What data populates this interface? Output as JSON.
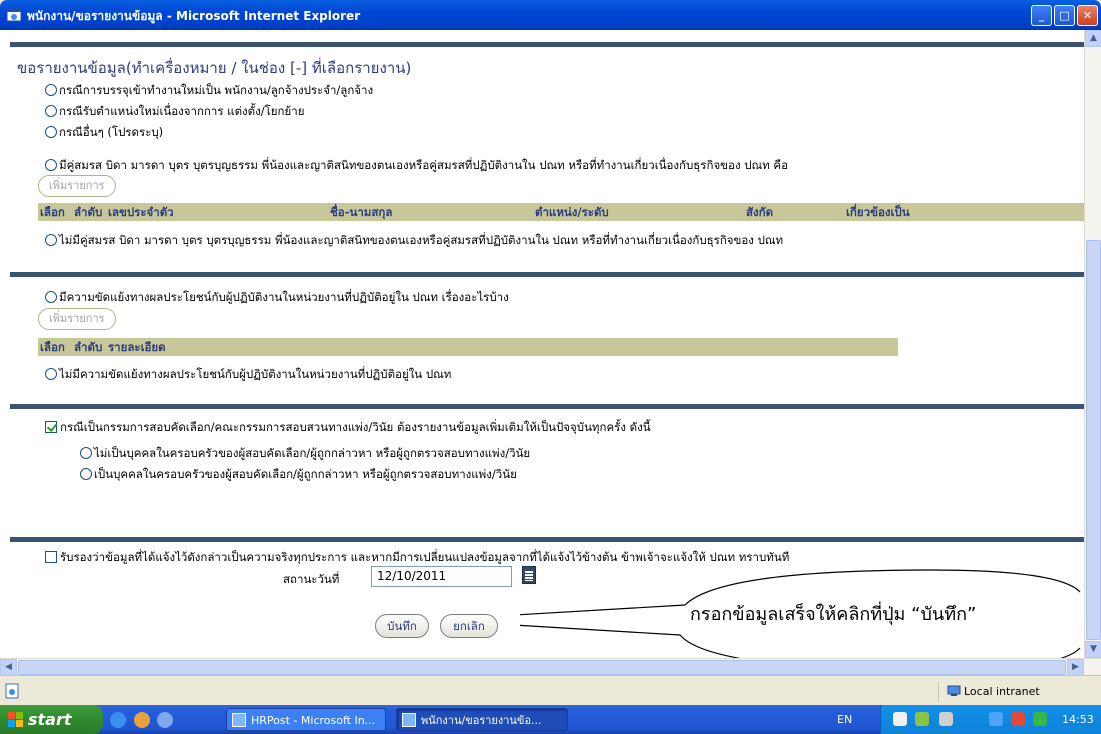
{
  "window": {
    "title": "พนักงาน/ขอรายงานข้อมูล - Microsoft Internet Explorer",
    "min": "_",
    "max": "□",
    "close": "✕"
  },
  "page": {
    "heading": "ขอรายงานข้อมูล(ทำเครื่องหมาย / ในช่อง [-] ที่เลือกรายงาน)",
    "section1": {
      "options": [
        "กรณีการบรรจุเข้าทำงานใหม่เป็น พนักงาน/ลูกจ้างประจำ/ลูกจ้าง",
        "กรณีรับตำแหน่งใหม่เนื่องจากการ แต่งตั้ง/โยกย้าย",
        "กรณีอื่นๆ (โปรดระบุ)"
      ]
    },
    "section2": {
      "has_relatives": "มีคู่สมรส บิดา มารดา บุตร บุตรบุญธรรม พี่น้องและญาติสนิทของตนเองหรือคู่สมรสที่ปฏิบัติงานใน ปณท หรือที่ทำงานเกี่ยวเนื่องกับธุรกิจของ ปณท คือ",
      "add_button": "เพิ่มรายการ",
      "table_headers": [
        "เลือก",
        "ลำดับ",
        "เลขประจำตัว",
        "ชื่อ-นามสกุล",
        "ตำแหน่ง/ระดับ",
        "สังกัด",
        "เกี่ยวข้องเป็น"
      ],
      "no_relatives": "ไม่มีคู่สมรส บิดา มารดา บุตร บุตรบุญธรรม พี่น้องและญาติสนิทของตนเองหรือคู่สมรสที่ปฏิบัติงานใน ปณท หรือที่ทำงานเกี่ยวเนื่องกับธุรกิจของ ปณท"
    },
    "section3": {
      "has_conflict": "มีความขัดแย้งทางผลประโยชน์กับผู้ปฏิบัติงานในหน่วยงานที่ปฏิบัติอยู่ใน ปณท เรื่องอะไรบ้าง",
      "add_button": "เพิ่มรายการ",
      "table_headers": [
        "เลือก",
        "ลำดับ",
        "รายละเอียด"
      ],
      "no_conflict": "ไม่มีความขัดแย้งทางผลประโยชน์กับผู้ปฏิบัติงานในหน่วยงานที่ปฏิบัติอยู่ใน ปณท"
    },
    "section4": {
      "committee": "กรณีเป็นกรรมการสอบคัดเลือก/คณะกรรมการสอบสวนทางแพ่ง/วินัย ต้องรายงานข้อมูลเพิ่มเติมให้เป็นปัจจุบันทุกครั้ง ดังนี้",
      "committee_checked": true,
      "sub_options": [
        "ไม่เป็นบุคคลในครอบครัวของผู้สอบคัดเลือก/ผู้ถูกกล่าวหา หรือผู้ถูกตรวจสอบทางแพ่ง/วินัย",
        "เป็นบุคคลในครอบครัวของผู้สอบคัดเลือก/ผู้ถูกกล่าวหา หรือผู้ถูกตรวจสอบทางแพ่ง/วินัย"
      ]
    },
    "section5": {
      "certify": "รับรองว่าข้อมูลที่ได้แจ้งไว้ดังกล่าวเป็นความจริงทุกประการ และหากมีการเปลี่ยนแปลงข้อมูลจากที่ได้แจ้งไว้ข้างต้น ข้าพเจ้าจะแจ้งให้ ปณท ทราบทันที",
      "date_label": "สถานะวันที่",
      "date_value": "12/10/2011",
      "save_button": "บันทึก",
      "cancel_button": "ยกเลิก"
    },
    "callout": "กรอกข้อมูลเสร็จให้คลิกที่ปุ่ม “บันทึก”"
  },
  "scroll": {
    "up": "▲",
    "down": "▼",
    "left": "◀",
    "right": "▶"
  },
  "status": {
    "zone": "Local intranet"
  },
  "taskbar": {
    "start": "start",
    "tasks": [
      "HRPost - Microsoft In...",
      "พนักงาน/ขอรายงานข้อ..."
    ],
    "lang": "EN",
    "clock": "14:53"
  },
  "colors": {
    "heading": "#2D3D7E",
    "table_header_bg": "#C7C79A",
    "section_rule": "#3A5373",
    "check": "#21A121"
  }
}
